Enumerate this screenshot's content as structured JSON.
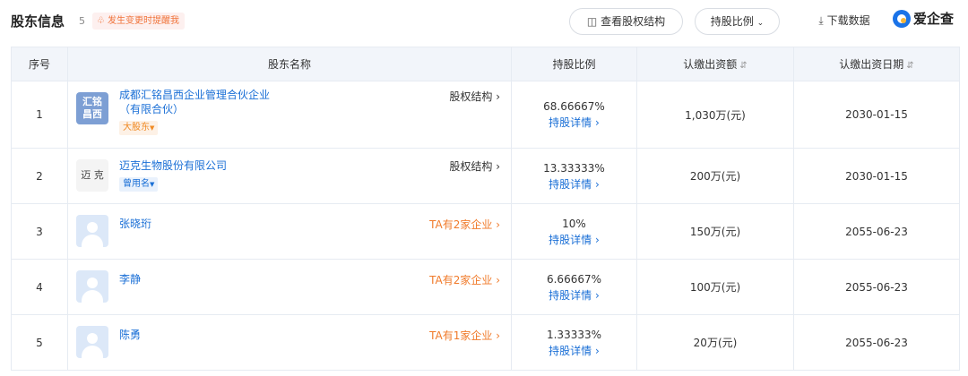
{
  "header": {
    "title": "股东信息",
    "count": "5",
    "remind_label": "发生变更时提醒我",
    "btn_structure": "查看股权结构",
    "btn_ratio": "持股比例",
    "btn_download": "下载数据",
    "logo_text": "爱企查"
  },
  "table": {
    "headers": {
      "idx": "序号",
      "name": "股东名称",
      "ratio": "持股比例",
      "amount": "认缴出资额",
      "date": "认缴出资日期"
    },
    "rows": [
      {
        "idx": "1",
        "name_line1": "成都汇铭昌西企业管理合伙企业",
        "name_line2": "（有限合伙）",
        "avatar_text1": "汇铭",
        "avatar_text2": "昌西",
        "tag": "大股东",
        "link": "股权结构",
        "ratio": "68.66667%",
        "detail": "持股详情",
        "amount": "1,030万(元)",
        "date": "2030-01-15"
      },
      {
        "idx": "2",
        "name_line1": "迈克生物股份有限公司",
        "avatar_text1": "迈 克",
        "tag": "曾用名",
        "link": "股权结构",
        "ratio": "13.33333%",
        "detail": "持股详情",
        "amount": "200万(元)",
        "date": "2030-01-15"
      },
      {
        "idx": "3",
        "name_line1": "张晓珩",
        "link": "TA有2家企业",
        "ratio": "10%",
        "detail": "持股详情",
        "amount": "150万(元)",
        "date": "2055-06-23"
      },
      {
        "idx": "4",
        "name_line1": "李静",
        "link": "TA有2家企业",
        "ratio": "6.66667%",
        "detail": "持股详情",
        "amount": "100万(元)",
        "date": "2055-06-23"
      },
      {
        "idx": "5",
        "name_line1": "陈勇",
        "link": "TA有1家企业",
        "ratio": "1.33333%",
        "detail": "持股详情",
        "amount": "20万(元)",
        "date": "2055-06-23"
      }
    ]
  },
  "icons": {
    "remind": "bell-icon",
    "structure": "structure-icon",
    "ratio": "chevron-down-icon",
    "download": "download-icon",
    "sort": "sort-icon",
    "link": "chevron-right-icon",
    "tag": "caret-down-icon"
  },
  "colors": {
    "link_blue": "#1a6fd6",
    "orange": "#f07a2a",
    "header_bg": "#f2f5fa"
  }
}
